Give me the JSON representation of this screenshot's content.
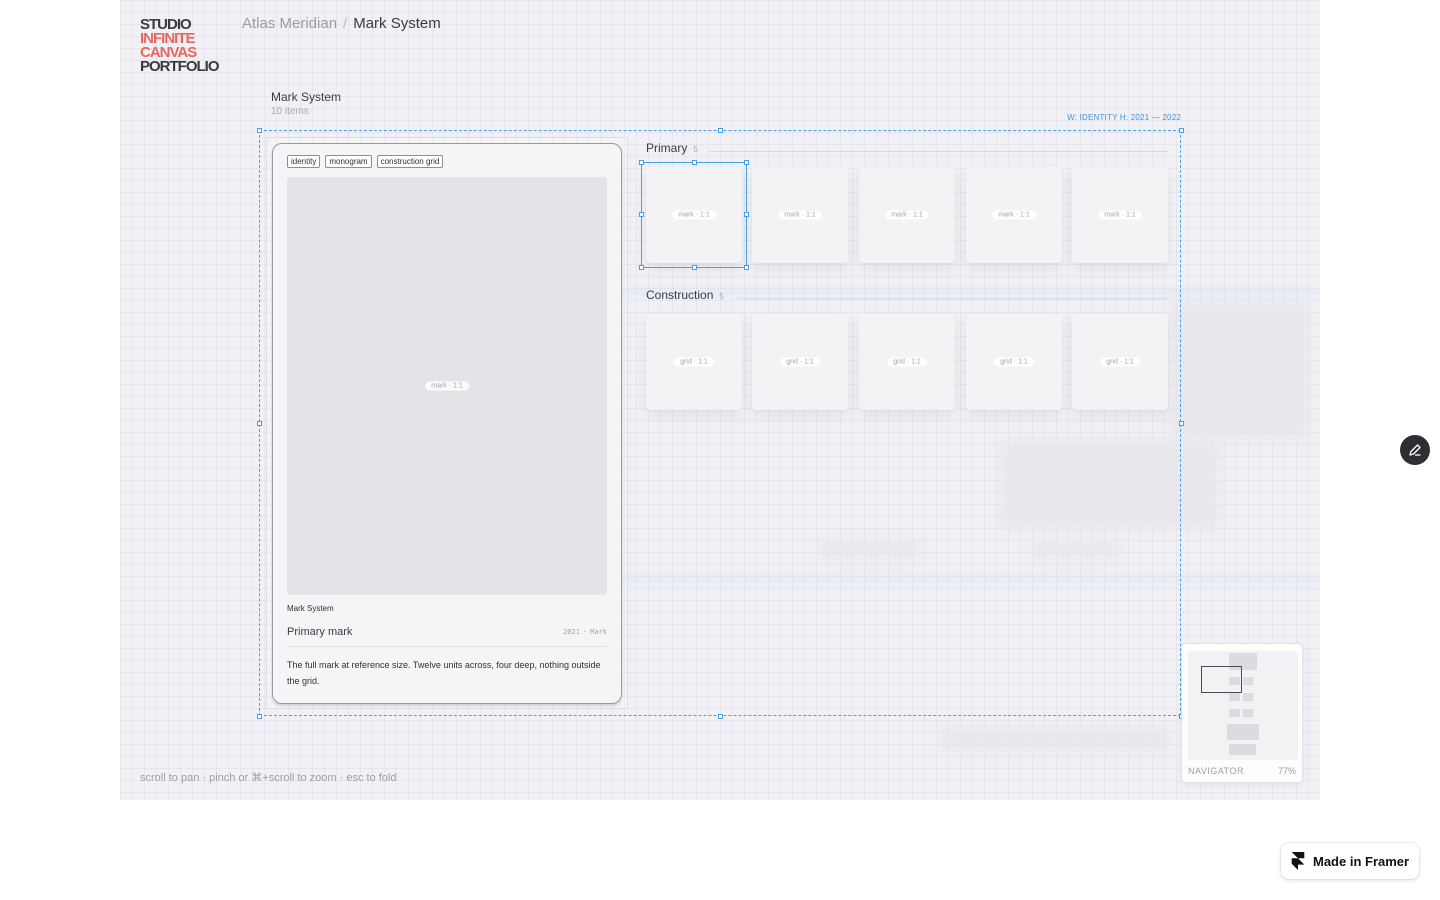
{
  "logo": {
    "line1": "STUDIO",
    "line2": "INFINITE",
    "line3": "CANVAS",
    "line4": "PORTFOLIO"
  },
  "breadcrumb": {
    "parent": "Atlas Meridian",
    "separator": "/",
    "current": "Mark System"
  },
  "section": {
    "title": "Mark System",
    "count": "10 items"
  },
  "selection": {
    "meta": "W: IDENTITY H: 2021 — 2022"
  },
  "detail_card": {
    "tags": [
      "identity",
      "monogram",
      "construction grid"
    ],
    "hero_pill": "mark · 1:1",
    "label": "Mark System",
    "title": "Primary mark",
    "year": "2021",
    "meta_separator": "·",
    "kind": "Mark",
    "description": "The full mark at reference size. Twelve units across, four deep, nothing outside the grid."
  },
  "rows": [
    {
      "title": "Primary",
      "count": "5",
      "tiles": [
        "mark · 1:1",
        "mark · 1:1",
        "mark · 1:1",
        "mark · 1:1",
        "mark · 1:1"
      ]
    },
    {
      "title": "Construction",
      "count": "5",
      "tiles": [
        "grid · 1:1",
        "grid · 1:1",
        "grid · 1:1",
        "grid · 1:1",
        "grid · 1:1"
      ]
    }
  ],
  "hint": "scroll to pan · pinch or ⌘+scroll to zoom · esc to fold",
  "navigator": {
    "label": "NAVIGATOR",
    "zoom": "77%"
  },
  "badge": {
    "label": "Made in Framer"
  },
  "colors": {
    "accent": "#4aa0e6",
    "logo_red": "#e8685f",
    "canvas_bg": "#f1f1f5"
  }
}
